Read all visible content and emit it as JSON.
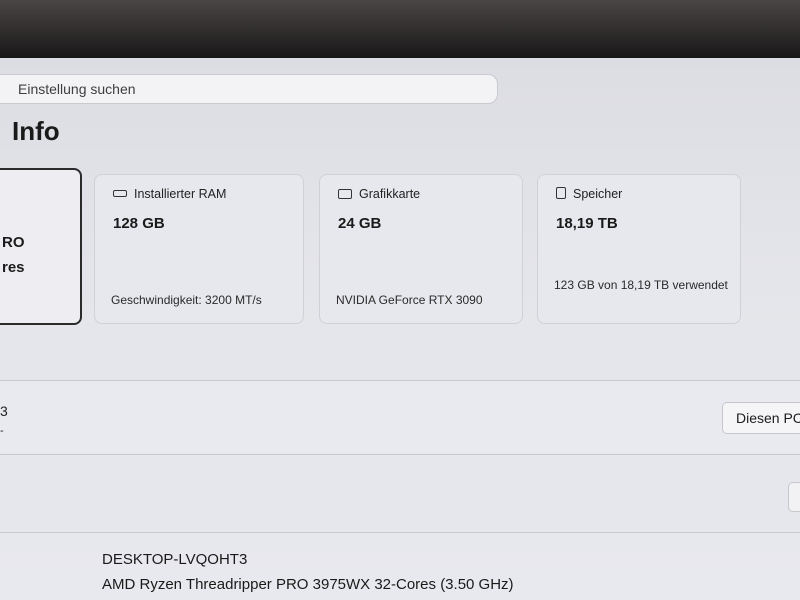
{
  "search": {
    "placeholder": "Einstellung suchen"
  },
  "page": {
    "title": "Info"
  },
  "device_card": {
    "line1": "RO",
    "line2": "res"
  },
  "cards": [
    {
      "icon": "ram-icon",
      "label": "Installierter RAM",
      "value": "128 GB",
      "footer": "Geschwindigkeit: 3200 MT/s"
    },
    {
      "icon": "gpu-icon",
      "label": "Grafikkarte",
      "value": "24 GB",
      "footer": "NVIDIA GeForce RTX 3090"
    },
    {
      "icon": "storage-icon",
      "label": "Speicher",
      "value": "18,19 TB",
      "footer": "123 GB von 18,19 TB verwendet"
    }
  ],
  "rename_row": {
    "fragment": "3",
    "fragment2": "-",
    "button_label": "Diesen PC"
  },
  "specs": {
    "device_name": "DESKTOP-LVQOHT3",
    "processor": "AMD Ryzen Threadripper PRO 3975WX 32-Cores (3.50 GHz)"
  }
}
